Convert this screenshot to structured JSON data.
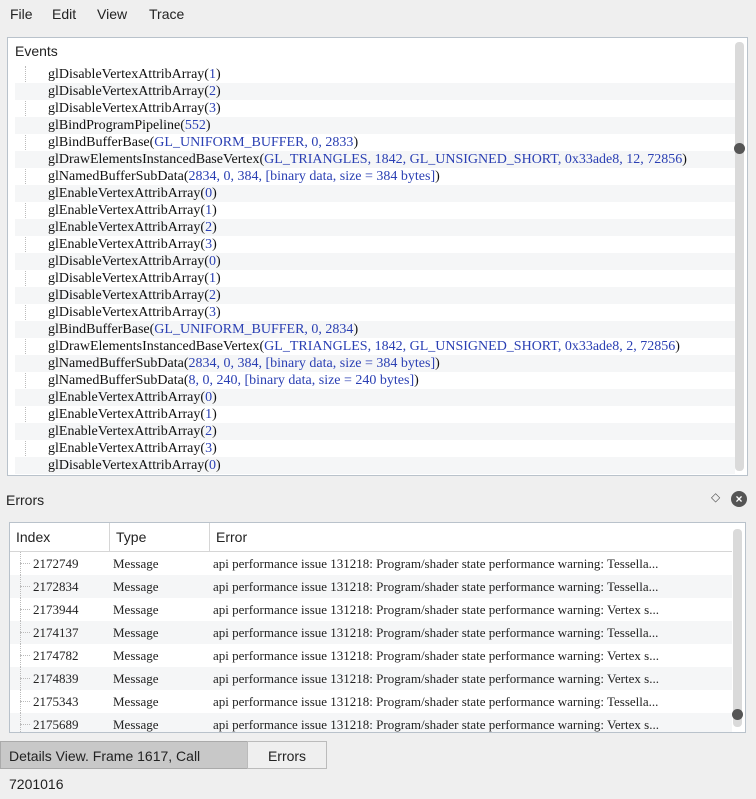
{
  "menu": [
    "File",
    "Edit",
    "View",
    "Trace"
  ],
  "events": {
    "title": "Events",
    "rows": [
      {
        "fn": "glDisableVertexAttribArray",
        "args": "1"
      },
      {
        "fn": "glDisableVertexAttribArray",
        "args": "2"
      },
      {
        "fn": "glDisableVertexAttribArray",
        "args": "3"
      },
      {
        "fn": "glBindProgramPipeline",
        "args": "552"
      },
      {
        "fn": "glBindBufferBase",
        "args": "GL_UNIFORM_BUFFER, 0, 2833"
      },
      {
        "fn": "glDrawElementsInstancedBaseVertex",
        "args": "GL_TRIANGLES, 1842, GL_UNSIGNED_SHORT, 0x33ade8, 12, 72856"
      },
      {
        "fn": "glNamedBufferSubData",
        "args": "2834, 0, 384, [binary data, size = 384 bytes]"
      },
      {
        "fn": "glEnableVertexAttribArray",
        "args": "0"
      },
      {
        "fn": "glEnableVertexAttribArray",
        "args": "1"
      },
      {
        "fn": "glEnableVertexAttribArray",
        "args": "2"
      },
      {
        "fn": "glEnableVertexAttribArray",
        "args": "3"
      },
      {
        "fn": "glDisableVertexAttribArray",
        "args": "0"
      },
      {
        "fn": "glDisableVertexAttribArray",
        "args": "1"
      },
      {
        "fn": "glDisableVertexAttribArray",
        "args": "2"
      },
      {
        "fn": "glDisableVertexAttribArray",
        "args": "3"
      },
      {
        "fn": "glBindBufferBase",
        "args": "GL_UNIFORM_BUFFER, 0, 2834"
      },
      {
        "fn": "glDrawElementsInstancedBaseVertex",
        "args": "GL_TRIANGLES, 1842, GL_UNSIGNED_SHORT, 0x33ade8, 2, 72856"
      },
      {
        "fn": "glNamedBufferSubData",
        "args": "2834, 0, 384, [binary data, size = 384 bytes]"
      },
      {
        "fn": "glNamedBufferSubData",
        "args": "8, 0, 240, [binary data, size = 240 bytes]"
      },
      {
        "fn": "glEnableVertexAttribArray",
        "args": "0"
      },
      {
        "fn": "glEnableVertexAttribArray",
        "args": "1"
      },
      {
        "fn": "glEnableVertexAttribArray",
        "args": "2"
      },
      {
        "fn": "glEnableVertexAttribArray",
        "args": "3"
      },
      {
        "fn": "glDisableVertexAttribArray",
        "args": "0"
      }
    ]
  },
  "errors": {
    "title": "Errors",
    "columns": [
      "Index",
      "Type",
      "Error"
    ],
    "rows": [
      {
        "index": "2172749",
        "type": "Message",
        "error": "api performance issue 131218: Program/shader state performance warning: Tessella..."
      },
      {
        "index": "2172834",
        "type": "Message",
        "error": "api performance issue 131218: Program/shader state performance warning: Tessella..."
      },
      {
        "index": "2173944",
        "type": "Message",
        "error": "api performance issue 131218: Program/shader state performance warning: Vertex s..."
      },
      {
        "index": "2174137",
        "type": "Message",
        "error": "api performance issue 131218: Program/shader state performance warning: Tessella..."
      },
      {
        "index": "2174782",
        "type": "Message",
        "error": "api performance issue 131218: Program/shader state performance warning: Vertex s..."
      },
      {
        "index": "2174839",
        "type": "Message",
        "error": "api performance issue 131218: Program/shader state performance warning: Vertex s..."
      },
      {
        "index": "2175343",
        "type": "Message",
        "error": "api performance issue 131218: Program/shader state performance warning: Tessella..."
      },
      {
        "index": "2175689",
        "type": "Message",
        "error": "api performance issue 131218: Program/shader state performance warning: Vertex s..."
      }
    ]
  },
  "tabs": {
    "details": "Details View. Frame 1617, Call 7201016",
    "errors": "Errors"
  },
  "icons": {
    "float": "diamond-icon",
    "close": "close-icon"
  }
}
